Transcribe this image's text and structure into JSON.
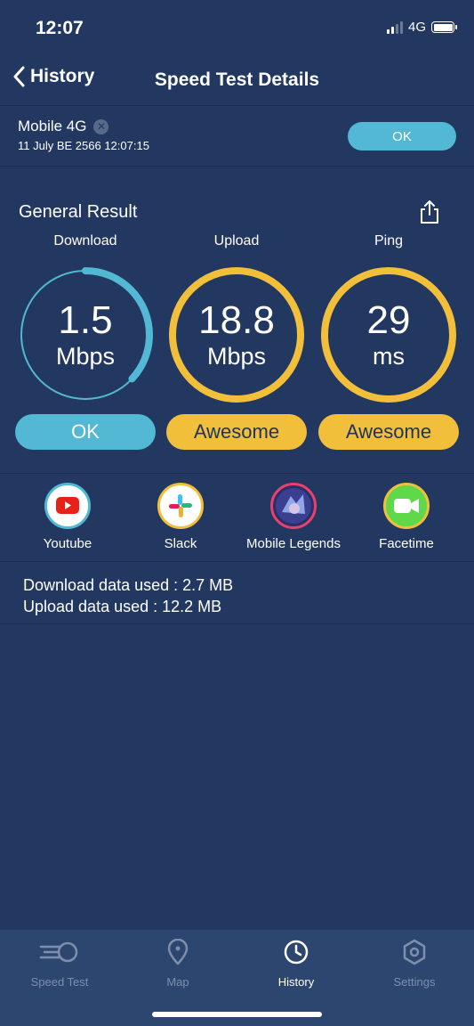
{
  "status_bar": {
    "time": "12:07",
    "network": "4G"
  },
  "nav": {
    "back_label": "History",
    "title": "Speed Test Details"
  },
  "connection": {
    "name": "Mobile 4G",
    "datetime": "11 July BE 2566 12:07:15",
    "badge": "OK"
  },
  "results": {
    "title": "General Result",
    "download": {
      "label": "Download",
      "value": "1.5",
      "unit": "Mbps",
      "rating": "OK",
      "gauge_fraction": 0.37,
      "color": "#52b8d4"
    },
    "upload": {
      "label": "Upload",
      "value": "18.8",
      "unit": "Mbps",
      "rating": "Awesome",
      "gauge_fraction": 1.0,
      "color": "#f2bf3b"
    },
    "ping": {
      "label": "Ping",
      "value": "29",
      "unit": "ms",
      "rating": "Awesome",
      "gauge_fraction": 1.0,
      "color": "#f2bf3b"
    }
  },
  "apps": [
    {
      "name": "Youtube",
      "icon": "youtube-icon"
    },
    {
      "name": "Slack",
      "icon": "slack-icon"
    },
    {
      "name": "Mobile Legends",
      "icon": "mobile-legends-icon"
    },
    {
      "name": "Facetime",
      "icon": "facetime-icon"
    }
  ],
  "data_used": {
    "download": "Download data used : 2.7 MB",
    "upload": "Upload data used : 12.2 MB"
  },
  "tabs": [
    {
      "label": "Speed Test",
      "icon": "speedometer-icon",
      "active": false
    },
    {
      "label": "Map",
      "icon": "map-pin-icon",
      "active": false
    },
    {
      "label": "History",
      "icon": "clock-icon",
      "active": true
    },
    {
      "label": "Settings",
      "icon": "settings-icon",
      "active": false
    }
  ],
  "colors": {
    "background": "#223861",
    "accent_blue": "#52b8d4",
    "accent_yellow": "#f2bf3b",
    "tab_bar": "#2d4670"
  }
}
